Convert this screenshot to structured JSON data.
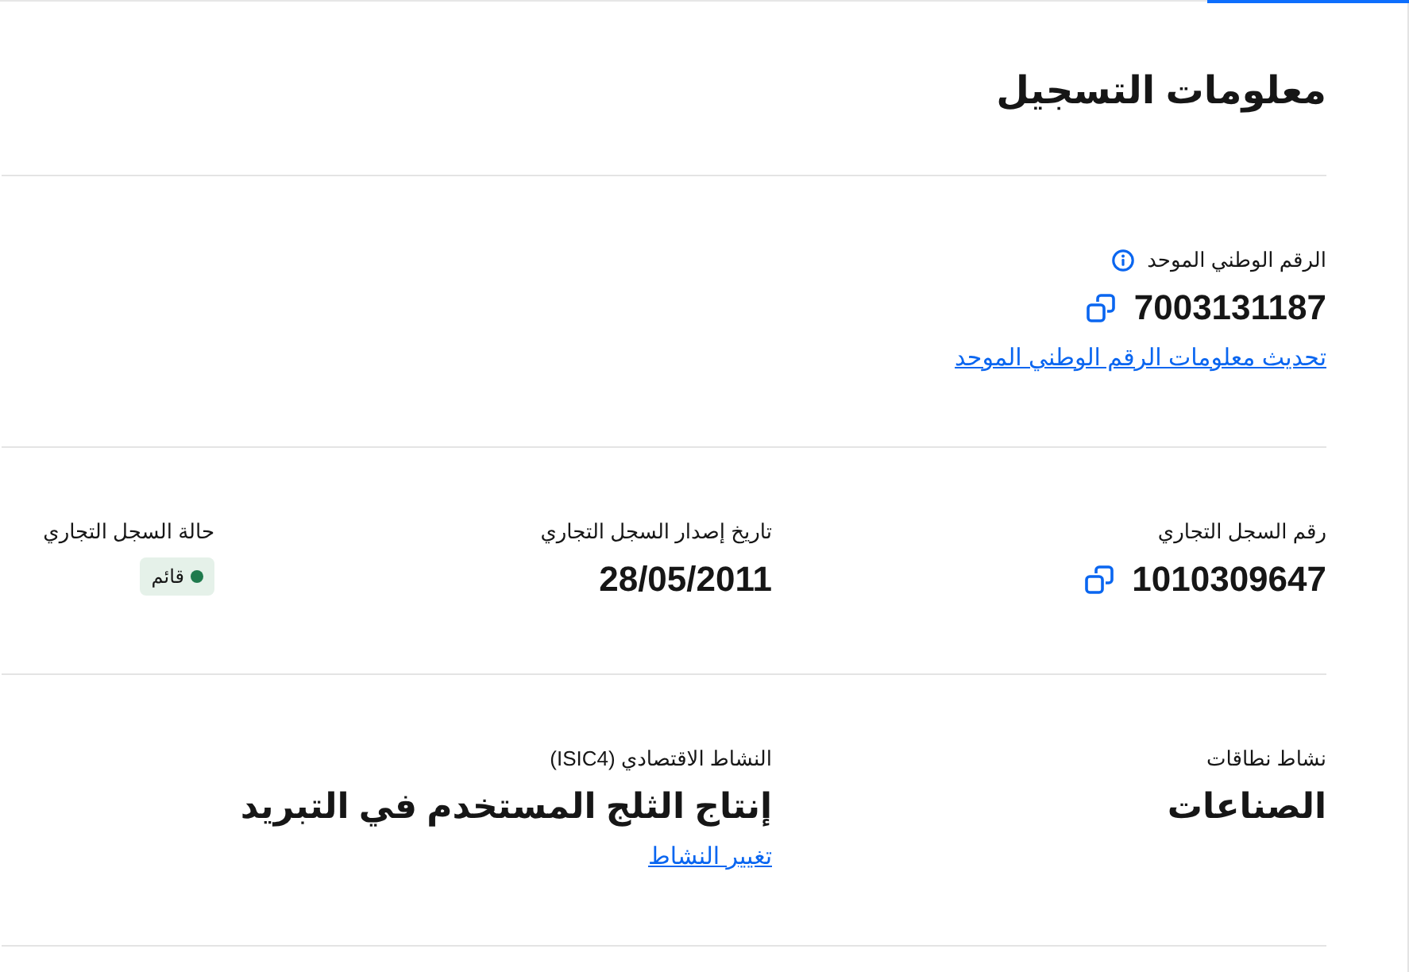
{
  "heading": "معلومات التسجيل",
  "sections": [
    {
      "fields": [
        {
          "kind": "value",
          "label": "الرقم الوطني الموحد",
          "info_icon": true,
          "value": "7003131187",
          "copy_button": true,
          "link": "تحديث معلومات الرقم الوطني الموحد"
        }
      ]
    },
    {
      "fields": [
        {
          "kind": "value",
          "label": "رقم السجل التجاري",
          "value": "1010309647",
          "copy_button": true
        },
        {
          "kind": "value",
          "label": "تاريخ إصدار السجل التجاري",
          "value": "28/05/2011"
        },
        {
          "kind": "status",
          "label": "حالة السجل التجاري",
          "status": {
            "label": "قائم",
            "color": "#1f7a4d"
          }
        }
      ]
    },
    {
      "fields": [
        {
          "kind": "value",
          "label": "نشاط نطاقات",
          "value": "الصناعات"
        },
        {
          "kind": "value",
          "label": "النشاط الاقتصادي (ISIC4)",
          "value": "إنتاج الثلج المستخدم في التبريد",
          "link": "تغيير النشاط"
        }
      ]
    }
  ]
}
